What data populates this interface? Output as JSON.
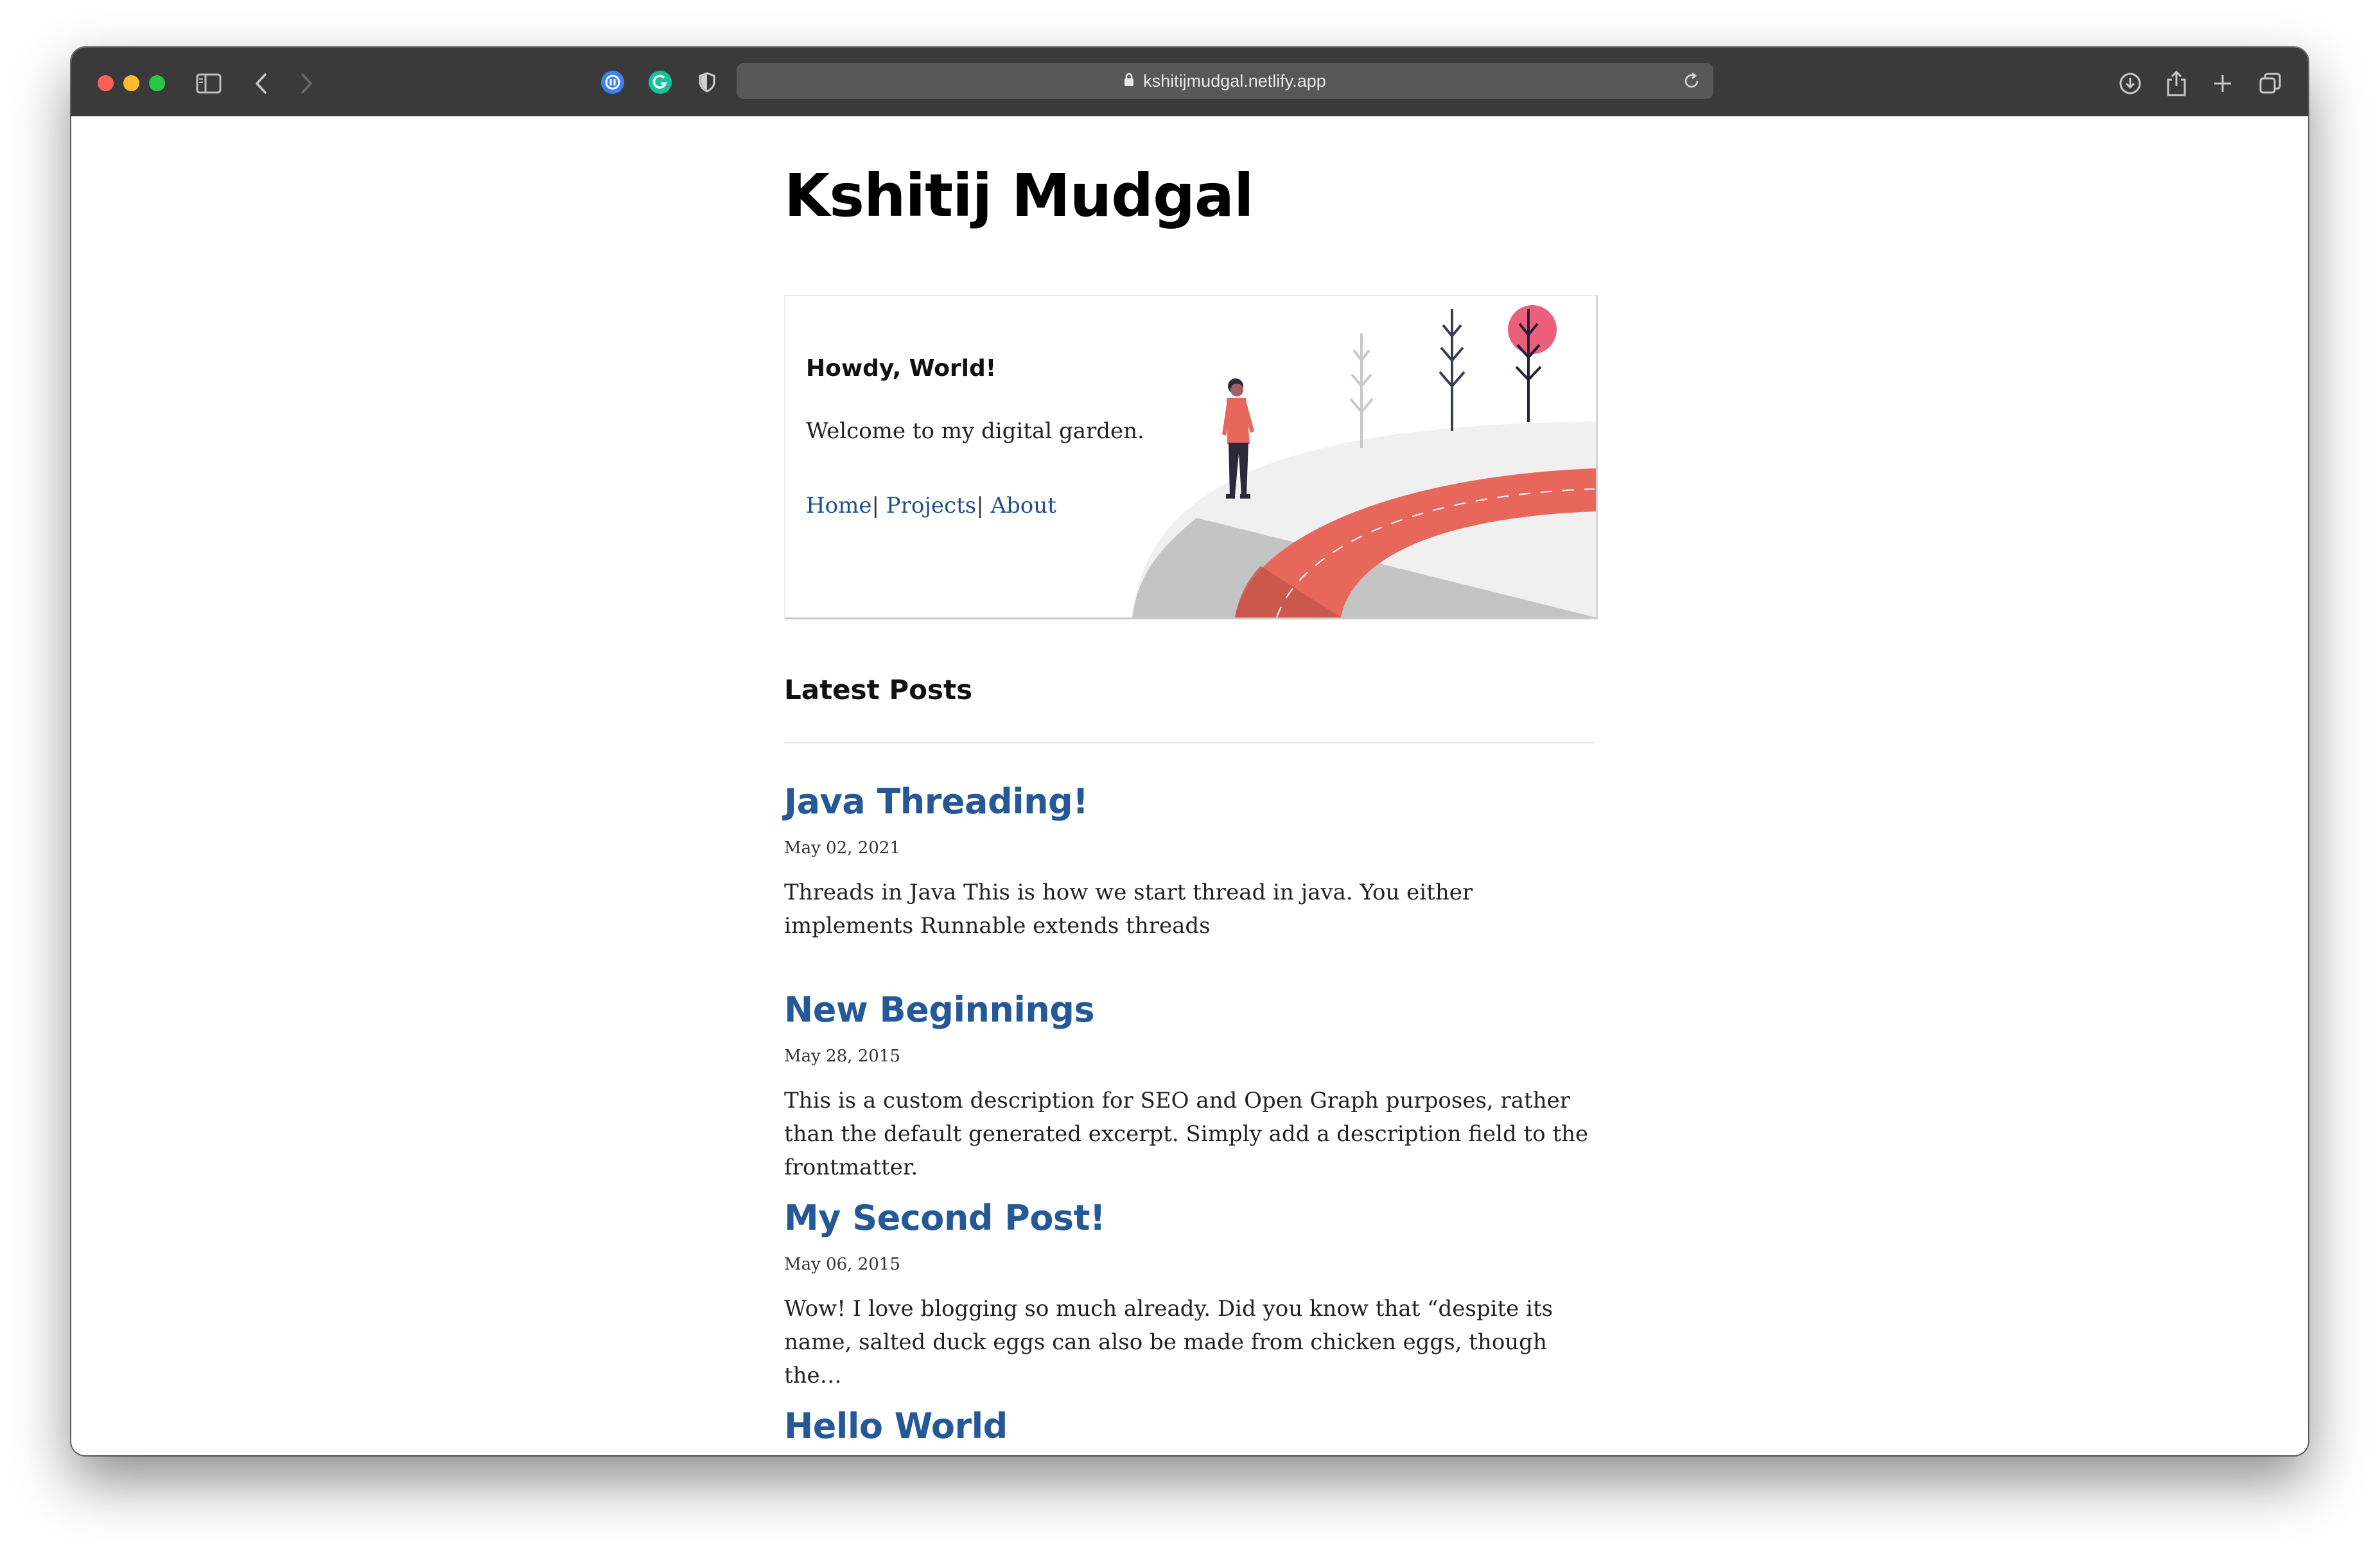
{
  "browser": {
    "url": "kshitijmudgal.netlify.app"
  },
  "site": {
    "title": "Kshitij Mudgal"
  },
  "hero": {
    "title": "Howdy, World!",
    "text": "Welcome to my digital garden.",
    "nav": [
      {
        "label": "Home"
      },
      {
        "label": "Projects"
      },
      {
        "label": "About"
      }
    ],
    "nav_separator": "|"
  },
  "posts_section": {
    "heading": "Latest Posts"
  },
  "posts": [
    {
      "title": "Java Threading!",
      "date": "May 02, 2021",
      "excerpt": "Threads in Java This is how we start thread in java. You either implements Runnable extends threads"
    },
    {
      "title": "New Beginnings",
      "date": "May 28, 2015",
      "excerpt": "This is a custom description for SEO and Open Graph purposes, rather than the default generated excerpt. Simply add a description field to the frontmatter."
    },
    {
      "title": "My Second Post!",
      "date": "May 06, 2015",
      "excerpt": "Wow! I love blogging so much already. Did you know that “despite its name, salted duck eggs can also be made from chicken eggs, though the…"
    },
    {
      "title": "Hello World",
      "date": "",
      "excerpt": ""
    }
  ],
  "colors": {
    "link": "#245896",
    "road": "#e8675b",
    "sun": "#ec5f7a"
  },
  "icons": [
    "sidebar-icon",
    "back-icon",
    "forward-icon",
    "extension-icon",
    "grammarly-icon",
    "shield-icon",
    "lock-icon",
    "reload-icon",
    "download-icon",
    "share-icon",
    "new-tab-icon",
    "tab-overview-icon"
  ]
}
